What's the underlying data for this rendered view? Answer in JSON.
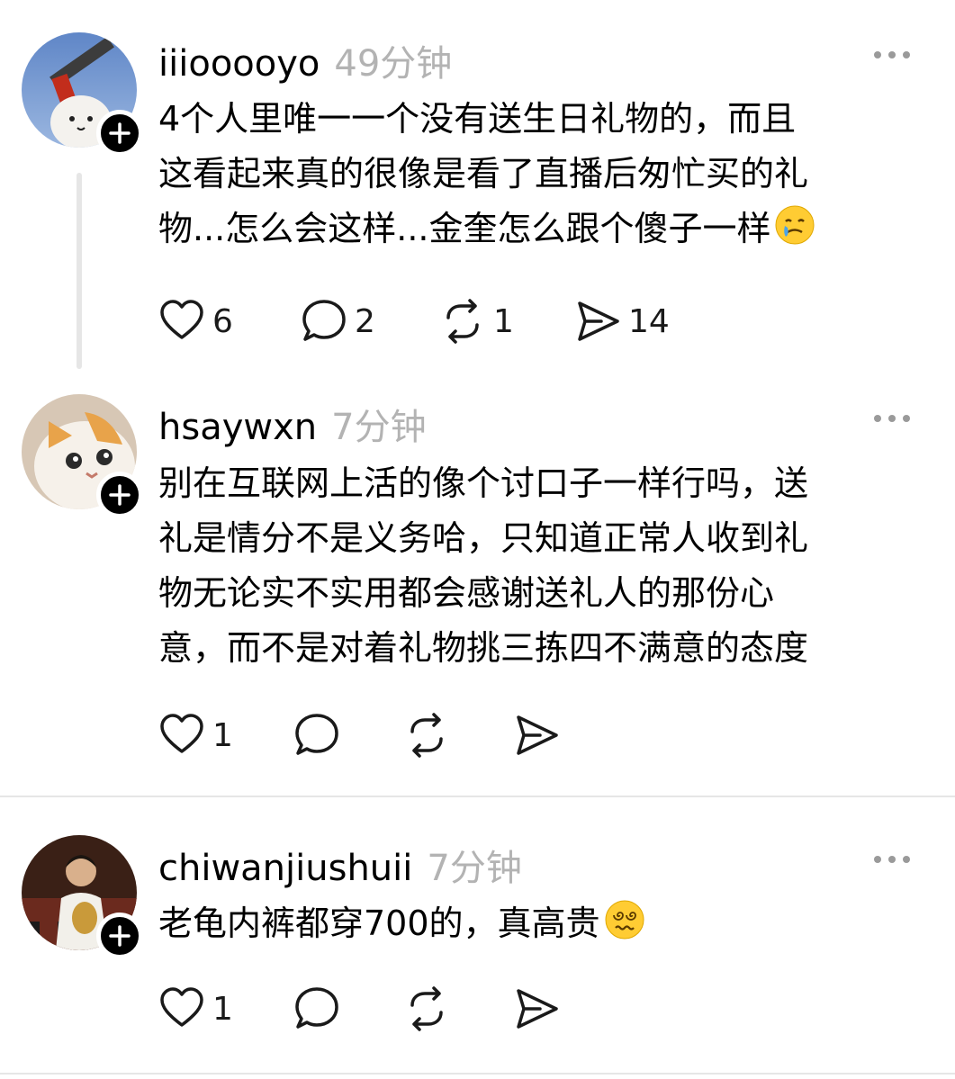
{
  "posts": [
    {
      "username": "iiiooooyo",
      "time": "49分钟",
      "lines": [
        "4个人里唯一一个没有送生日礼物的，而且",
        "这看起来真的很像是看了直播后匆忙买的礼",
        "物...怎么会这样...金奎怎么跟个傻子一样"
      ],
      "emoji": "tear-smile-emoji",
      "likes": "6",
      "comments": "2",
      "reposts": "1",
      "shares": "14"
    },
    {
      "username": "hsaywxn",
      "time": "7分钟",
      "lines": [
        "别在互联网上活的像个讨口子一样行吗，送",
        "礼是情分不是义务哈，只知道正常人收到礼",
        "物无论实不实用都会感谢送礼人的那份心",
        "意，而不是对着礼物挑三拣四不满意的态度"
      ],
      "likes": "1"
    },
    {
      "username": "chiwanjiushuii",
      "time": "7分钟",
      "lines": [
        "老龟内裤都穿700的，真高贵"
      ],
      "emoji": "dizzy-face-emoji",
      "likes": "1"
    }
  ],
  "colors": {
    "text": "#000000",
    "muted": "#b3b3b3",
    "divider": "#e6e6e6",
    "badge": "#000000"
  }
}
